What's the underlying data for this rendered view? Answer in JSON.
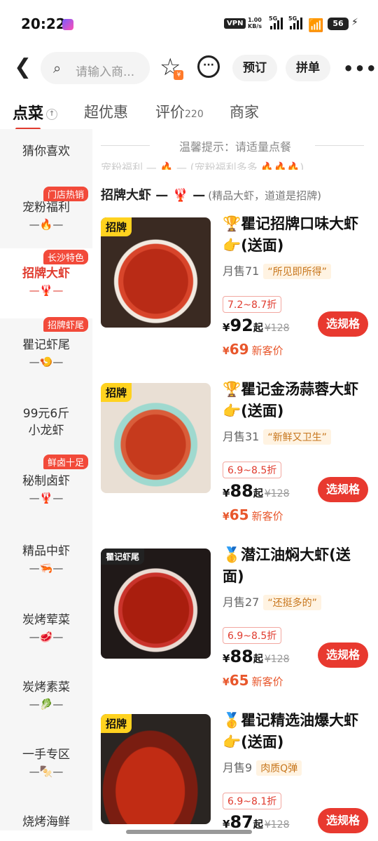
{
  "status": {
    "time": "20:22",
    "vpn": "VPN",
    "speed_top": "1.00",
    "speed_unit": "KB/s",
    "sig1": "5G",
    "sig2": "5G",
    "battery": "56"
  },
  "nav": {
    "search_placeholder": "请输入商...",
    "reserve": "预订",
    "group": "拼单"
  },
  "tabs": [
    {
      "label": "点菜"
    },
    {
      "label": "超优惠"
    },
    {
      "label": "评价",
      "count": "220"
    },
    {
      "label": "商家"
    }
  ],
  "sidebar": [
    {
      "name": "猜你喜欢",
      "emoji": "",
      "badge": ""
    },
    {
      "name": "宠粉福利",
      "emoji": "—🔥—",
      "badge": "门店热销"
    },
    {
      "name": "招牌大虾",
      "emoji": "—🦞—",
      "badge": "长沙特色"
    },
    {
      "name": "瞿记虾尾",
      "emoji": "—🍤—",
      "badge": "招牌虾尾"
    },
    {
      "name": "99元6斤",
      "name2": "小龙虾",
      "emoji": "",
      "badge": ""
    },
    {
      "name": "秘制卤虾",
      "emoji": "—🦞—",
      "badge": "鲜卤十足"
    },
    {
      "name": "精品中虾",
      "emoji": "—🦐—",
      "badge": ""
    },
    {
      "name": "炭烤荤菜",
      "emoji": "—🥩—",
      "badge": ""
    },
    {
      "name": "炭烤素菜",
      "emoji": "—🥬—",
      "badge": ""
    },
    {
      "name": "一手专区",
      "emoji": "—🍢—",
      "badge": ""
    },
    {
      "name": "烧烤海鲜",
      "emoji": "",
      "badge": ""
    }
  ],
  "main": {
    "tip": "温馨提示：请适量点餐",
    "section_title": "招牌大虾 — 🦞 —",
    "section_sub": "(精品大虾，道道是招牌)",
    "items": [
      {
        "tag": "招牌",
        "title": "🏆瞿记招牌口味大虾👉(送面)",
        "sold": "月售71",
        "quote": "“所见即所得”",
        "disc": "7.2~8.7折",
        "price": "92",
        "qi": "起",
        "orig": "¥128",
        "newp": "69",
        "newp_label": "新客价",
        "btn": "选规格"
      },
      {
        "tag": "招牌",
        "title": "🏆瞿记金汤蒜蓉大虾👉(送面)",
        "sold": "月售31",
        "quote": "“新鲜又卫生”",
        "disc": "6.9~8.5折",
        "price": "88",
        "qi": "起",
        "orig": "¥128",
        "newp": "65",
        "newp_label": "新客价",
        "btn": "选规格"
      },
      {
        "tag": "瞿记虾尾",
        "title": "🥇潜江油焖大虾(送面)",
        "sold": "月售27",
        "quote": "“还挺多的”",
        "disc": "6.9~8.5折",
        "price": "88",
        "qi": "起",
        "orig": "¥128",
        "newp": "65",
        "newp_label": "新客价",
        "btn": "选规格"
      },
      {
        "tag": "招牌",
        "title": "🥇瞿记精选油爆大虾👉(送面)",
        "sold": "月售9",
        "quote": "肉质Q弹",
        "disc": "6.9~8.1折",
        "price": "87",
        "qi": "起",
        "orig": "¥128",
        "newp": "",
        "newp_label": "",
        "btn": "选规格"
      }
    ]
  },
  "colors": {
    "accent": "#e8392f",
    "badge": "#f24a3a",
    "price_new": "#e8572c",
    "tag_yellow": "#ffd21f"
  }
}
